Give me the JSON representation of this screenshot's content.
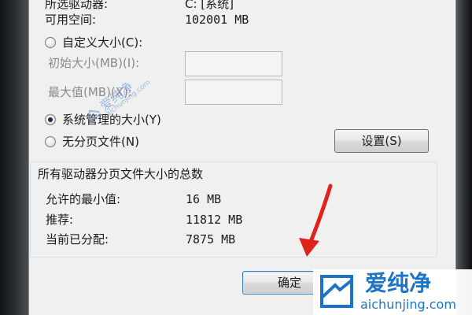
{
  "dialog": {
    "selected_drive_label": "所选驱动器:",
    "selected_drive_value": "C:  [系统]",
    "free_space_label": "可用空间:",
    "free_space_value": "102001 MB",
    "custom_size_label": "自定义大小(C):",
    "initial_size_label": "初始大小(MB)(I):",
    "initial_size_value": "",
    "max_size_label": "最大值(MB)(X):",
    "max_size_value": "",
    "system_managed_label": "系统管理的大小(Y)",
    "no_paging_label": "无分页文件(N)",
    "set_button": "设置(S)",
    "selected_option": "system_managed"
  },
  "totals": {
    "title": "所有驱动器分页文件大小的总数",
    "min_allowed_label": "允许的最小值:",
    "min_allowed_value": "16 MB",
    "recommended_label": "推荐:",
    "recommended_value": "11812 MB",
    "current_label": "当前已分配:",
    "current_value": "7875 MB"
  },
  "footer": {
    "ok_button": "确定"
  },
  "watermark": {
    "brand_cn": "爱纯净",
    "brand_url": "aichunjing.com",
    "diagonal_cn": "爱纯净",
    "diagonal_url": "aichunjing.com"
  },
  "colors": {
    "dialog_bg": "#f0f0f0",
    "arrow": "#e0221c",
    "brand_blue": "#1c74c8"
  }
}
